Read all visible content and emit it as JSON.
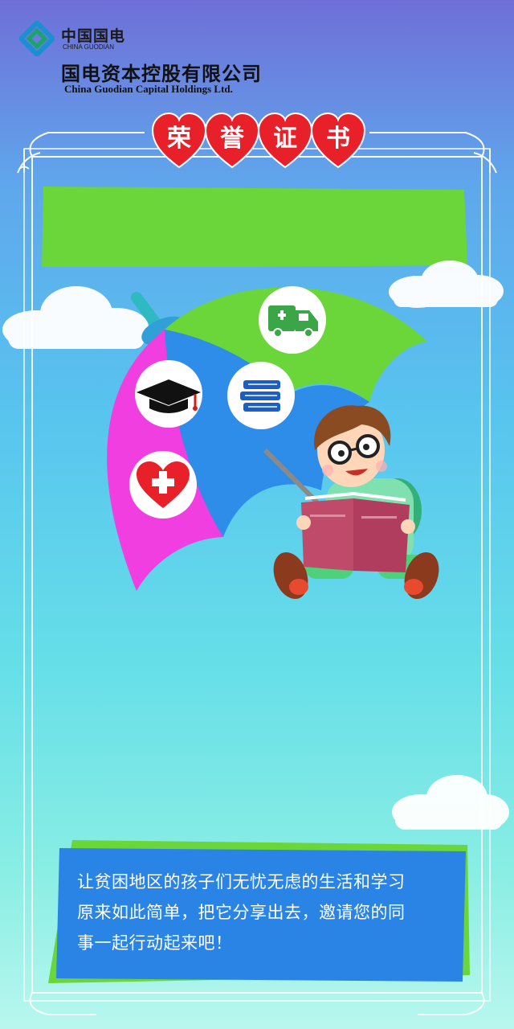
{
  "header": {
    "brand_cn": "中国国电",
    "brand_en": "CHINA GUODIAN",
    "company_cn": "国电资本控股有限公司",
    "company_en": "China Guodian Capital Holdings Ltd."
  },
  "title": {
    "chars": [
      "荣",
      "誉",
      "证",
      "书"
    ]
  },
  "icons": {
    "ambulance": "ambulance-icon",
    "graduation": "graduation-cap-icon",
    "books": "books-icon",
    "health": "heart-cross-icon"
  },
  "message": {
    "line1": "让贫困地区的孩子们无忧无虑的生活和学习",
    "line2": "原来如此简单，把它分享出去，邀请您的同",
    "line3": "事一起行动起来吧！"
  },
  "colors": {
    "heart_red": "#e8202a",
    "banner_green": "#6ad63a",
    "umbrella_blue": "#2d8de8",
    "umbrella_magenta": "#f03ee0",
    "text_box_blue": "#2a84e6"
  }
}
